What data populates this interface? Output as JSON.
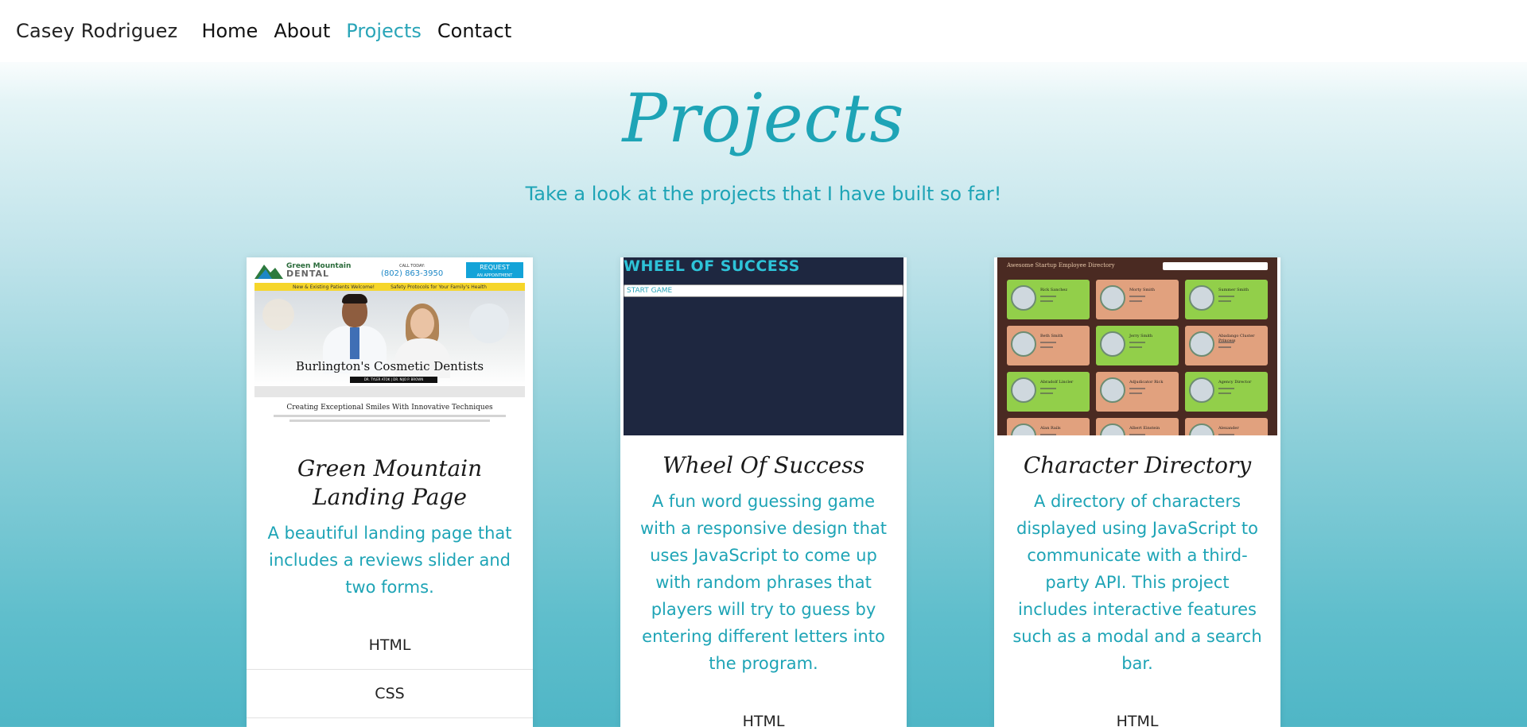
{
  "nav": {
    "brand": "Casey Rodriguez",
    "links": [
      "Home",
      "About",
      "Projects",
      "Contact"
    ]
  },
  "hero": {
    "title": "Projects",
    "subtitle": "Take a look at the projects that I have built so far!"
  },
  "colors": {
    "accent": "#1ea4b6",
    "nav_active": "#2aa5b8"
  },
  "projects": [
    {
      "title": "Green Mountain Landing Page",
      "description": "A beautiful landing page that includes a reviews slider and two forms.",
      "tech": [
        "HTML",
        "CSS"
      ],
      "thumb": {
        "logo_top": "Green Mountain",
        "logo_main": "DENTAL",
        "call_label": "CALL TODAY:",
        "phone": "(802) 863-3950",
        "request": "REQUEST",
        "request_sub": "AN APPOINTMENT",
        "banner_left": "New & Existing Patients Welcome!",
        "banner_right": "Safety Protocols for Your Family's Health",
        "headline": "Burlington's Cosmetic Dentists",
        "doctors": "DR. TYLER ATOK | DR. NIJO P. BROWN",
        "subheadline": "Creating Exceptional Smiles With Innovative Techniques"
      }
    },
    {
      "title": "Wheel Of Success",
      "description": "A fun word guessing game with a responsive design that uses JavaScript to come up with random phrases that players will try to guess by entering different letters into the program.",
      "tech": [
        "HTML"
      ],
      "thumb": {
        "game_title": "WHEEL OF SUCCESS",
        "start_button": "START GAME"
      }
    },
    {
      "title": "Character Directory",
      "description": "A directory of characters displayed using JavaScript to communicate with a third-party API. This project includes interactive features such as a modal and a search bar.",
      "tech": [
        "HTML"
      ],
      "thumb": {
        "header": "Awesome Startup Employee Directory",
        "characters": [
          "Rick Sanchez",
          "Morty Smith",
          "Summer Smith",
          "Beth Smith",
          "Jerry Smith",
          "Abadango Cluster Princess",
          "Abradolf Lincler",
          "Adjudicator Rick",
          "Agency Director",
          "Alan Rails",
          "Albert Einstein",
          "Alexander"
        ],
        "tile_colors": [
          "green",
          "peach",
          "green",
          "peach",
          "green",
          "peach",
          "green",
          "peach",
          "green",
          "peach",
          "peach",
          "peach"
        ]
      }
    }
  ]
}
